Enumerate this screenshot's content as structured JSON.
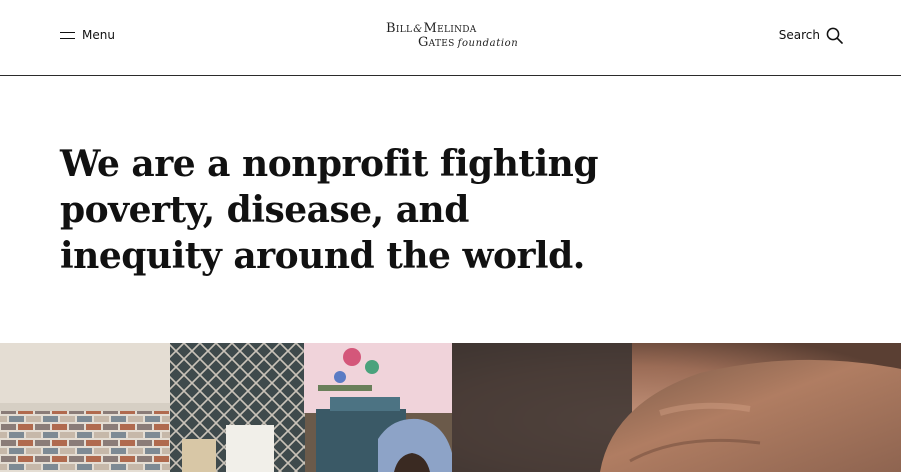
{
  "header": {
    "menu_label": "Menu",
    "search_label": "Search",
    "logo": {
      "line1_part1": "Bill",
      "line1_amp": "&",
      "line1_part2": "Melinda",
      "line2_part1": "Gates",
      "line2_part2": "foundation"
    },
    "icons": {
      "menu": "hamburger-menu-icon",
      "search": "search-icon"
    }
  },
  "main": {
    "headline": "We are a nonprofit fighting poverty, disease, and inequity around the world."
  },
  "colors": {
    "text": "#111111",
    "background": "#ffffff",
    "divider": "#2b2b2b"
  }
}
